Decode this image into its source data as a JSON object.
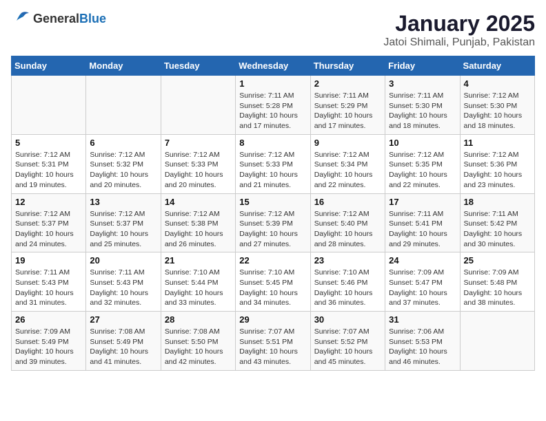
{
  "header": {
    "logo": {
      "general": "General",
      "blue": "Blue"
    },
    "title": "January 2025",
    "subtitle": "Jatoi Shimali, Punjab, Pakistan"
  },
  "weekdays": [
    "Sunday",
    "Monday",
    "Tuesday",
    "Wednesday",
    "Thursday",
    "Friday",
    "Saturday"
  ],
  "weeks": [
    [
      {
        "day": "",
        "info": ""
      },
      {
        "day": "",
        "info": ""
      },
      {
        "day": "",
        "info": ""
      },
      {
        "day": "1",
        "info": "Sunrise: 7:11 AM\nSunset: 5:28 PM\nDaylight: 10 hours and 17 minutes."
      },
      {
        "day": "2",
        "info": "Sunrise: 7:11 AM\nSunset: 5:29 PM\nDaylight: 10 hours and 17 minutes."
      },
      {
        "day": "3",
        "info": "Sunrise: 7:11 AM\nSunset: 5:30 PM\nDaylight: 10 hours and 18 minutes."
      },
      {
        "day": "4",
        "info": "Sunrise: 7:12 AM\nSunset: 5:30 PM\nDaylight: 10 hours and 18 minutes."
      }
    ],
    [
      {
        "day": "5",
        "info": "Sunrise: 7:12 AM\nSunset: 5:31 PM\nDaylight: 10 hours and 19 minutes."
      },
      {
        "day": "6",
        "info": "Sunrise: 7:12 AM\nSunset: 5:32 PM\nDaylight: 10 hours and 20 minutes."
      },
      {
        "day": "7",
        "info": "Sunrise: 7:12 AM\nSunset: 5:33 PM\nDaylight: 10 hours and 20 minutes."
      },
      {
        "day": "8",
        "info": "Sunrise: 7:12 AM\nSunset: 5:33 PM\nDaylight: 10 hours and 21 minutes."
      },
      {
        "day": "9",
        "info": "Sunrise: 7:12 AM\nSunset: 5:34 PM\nDaylight: 10 hours and 22 minutes."
      },
      {
        "day": "10",
        "info": "Sunrise: 7:12 AM\nSunset: 5:35 PM\nDaylight: 10 hours and 22 minutes."
      },
      {
        "day": "11",
        "info": "Sunrise: 7:12 AM\nSunset: 5:36 PM\nDaylight: 10 hours and 23 minutes."
      }
    ],
    [
      {
        "day": "12",
        "info": "Sunrise: 7:12 AM\nSunset: 5:37 PM\nDaylight: 10 hours and 24 minutes."
      },
      {
        "day": "13",
        "info": "Sunrise: 7:12 AM\nSunset: 5:37 PM\nDaylight: 10 hours and 25 minutes."
      },
      {
        "day": "14",
        "info": "Sunrise: 7:12 AM\nSunset: 5:38 PM\nDaylight: 10 hours and 26 minutes."
      },
      {
        "day": "15",
        "info": "Sunrise: 7:12 AM\nSunset: 5:39 PM\nDaylight: 10 hours and 27 minutes."
      },
      {
        "day": "16",
        "info": "Sunrise: 7:12 AM\nSunset: 5:40 PM\nDaylight: 10 hours and 28 minutes."
      },
      {
        "day": "17",
        "info": "Sunrise: 7:11 AM\nSunset: 5:41 PM\nDaylight: 10 hours and 29 minutes."
      },
      {
        "day": "18",
        "info": "Sunrise: 7:11 AM\nSunset: 5:42 PM\nDaylight: 10 hours and 30 minutes."
      }
    ],
    [
      {
        "day": "19",
        "info": "Sunrise: 7:11 AM\nSunset: 5:43 PM\nDaylight: 10 hours and 31 minutes."
      },
      {
        "day": "20",
        "info": "Sunrise: 7:11 AM\nSunset: 5:43 PM\nDaylight: 10 hours and 32 minutes."
      },
      {
        "day": "21",
        "info": "Sunrise: 7:10 AM\nSunset: 5:44 PM\nDaylight: 10 hours and 33 minutes."
      },
      {
        "day": "22",
        "info": "Sunrise: 7:10 AM\nSunset: 5:45 PM\nDaylight: 10 hours and 34 minutes."
      },
      {
        "day": "23",
        "info": "Sunrise: 7:10 AM\nSunset: 5:46 PM\nDaylight: 10 hours and 36 minutes."
      },
      {
        "day": "24",
        "info": "Sunrise: 7:09 AM\nSunset: 5:47 PM\nDaylight: 10 hours and 37 minutes."
      },
      {
        "day": "25",
        "info": "Sunrise: 7:09 AM\nSunset: 5:48 PM\nDaylight: 10 hours and 38 minutes."
      }
    ],
    [
      {
        "day": "26",
        "info": "Sunrise: 7:09 AM\nSunset: 5:49 PM\nDaylight: 10 hours and 39 minutes."
      },
      {
        "day": "27",
        "info": "Sunrise: 7:08 AM\nSunset: 5:49 PM\nDaylight: 10 hours and 41 minutes."
      },
      {
        "day": "28",
        "info": "Sunrise: 7:08 AM\nSunset: 5:50 PM\nDaylight: 10 hours and 42 minutes."
      },
      {
        "day": "29",
        "info": "Sunrise: 7:07 AM\nSunset: 5:51 PM\nDaylight: 10 hours and 43 minutes."
      },
      {
        "day": "30",
        "info": "Sunrise: 7:07 AM\nSunset: 5:52 PM\nDaylight: 10 hours and 45 minutes."
      },
      {
        "day": "31",
        "info": "Sunrise: 7:06 AM\nSunset: 5:53 PM\nDaylight: 10 hours and 46 minutes."
      },
      {
        "day": "",
        "info": ""
      }
    ]
  ]
}
